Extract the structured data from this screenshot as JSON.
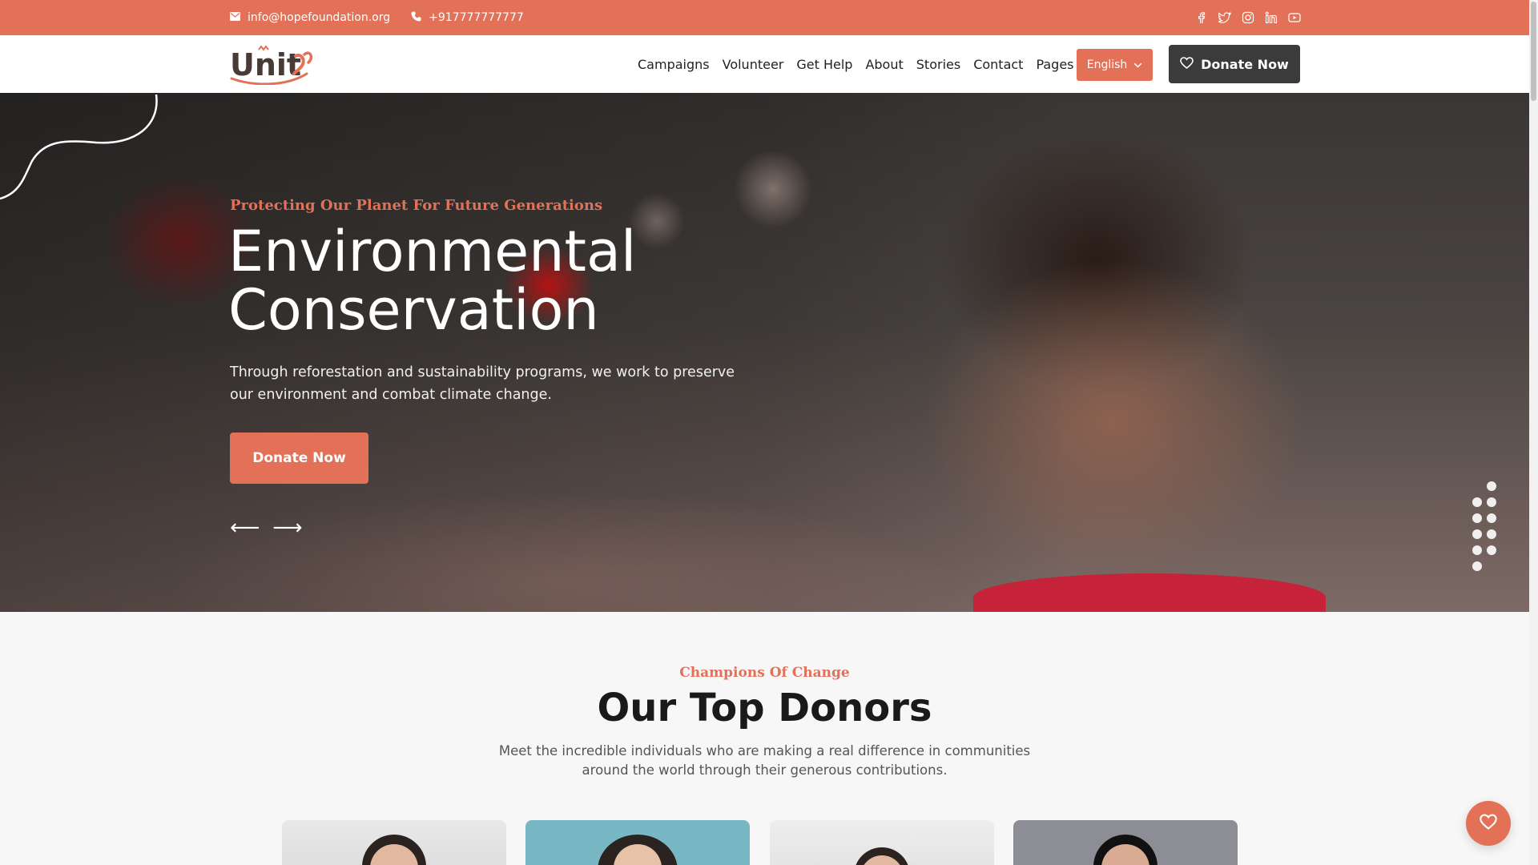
{
  "topbar": {
    "email": "info@hopefoundation.org",
    "phone": "+917777777777",
    "social_icons": [
      "facebook-icon",
      "twitter-icon",
      "instagram-icon",
      "linkedin-icon",
      "youtube-icon"
    ]
  },
  "header": {
    "logo_text": "Unity",
    "nav": [
      {
        "label": "Campaigns"
      },
      {
        "label": "Volunteer"
      },
      {
        "label": "Get Help"
      },
      {
        "label": "About"
      },
      {
        "label": "Stories"
      },
      {
        "label": "Contact"
      },
      {
        "label": "Pages"
      }
    ],
    "language": "English",
    "donate_label": "Donate Now"
  },
  "hero": {
    "tagline": "Protecting Our Planet For Future Generations",
    "title_line1": "Environmental",
    "title_line2": "Conservation",
    "description": "Through reforestation and sustainability programs, we work to preserve our environment and combat climate change.",
    "donate_label": "Donate Now",
    "prev_arrow": "⟵",
    "next_arrow": "⟶"
  },
  "donors": {
    "eyebrow": "Champions Of Change",
    "heading": "Our Top Donors",
    "subtitle": "Meet the incredible individuals who are making a real difference in communities around the world through their generous contributions."
  },
  "colors": {
    "accent": "#e27157",
    "dark_button": "#3b3b3b"
  }
}
